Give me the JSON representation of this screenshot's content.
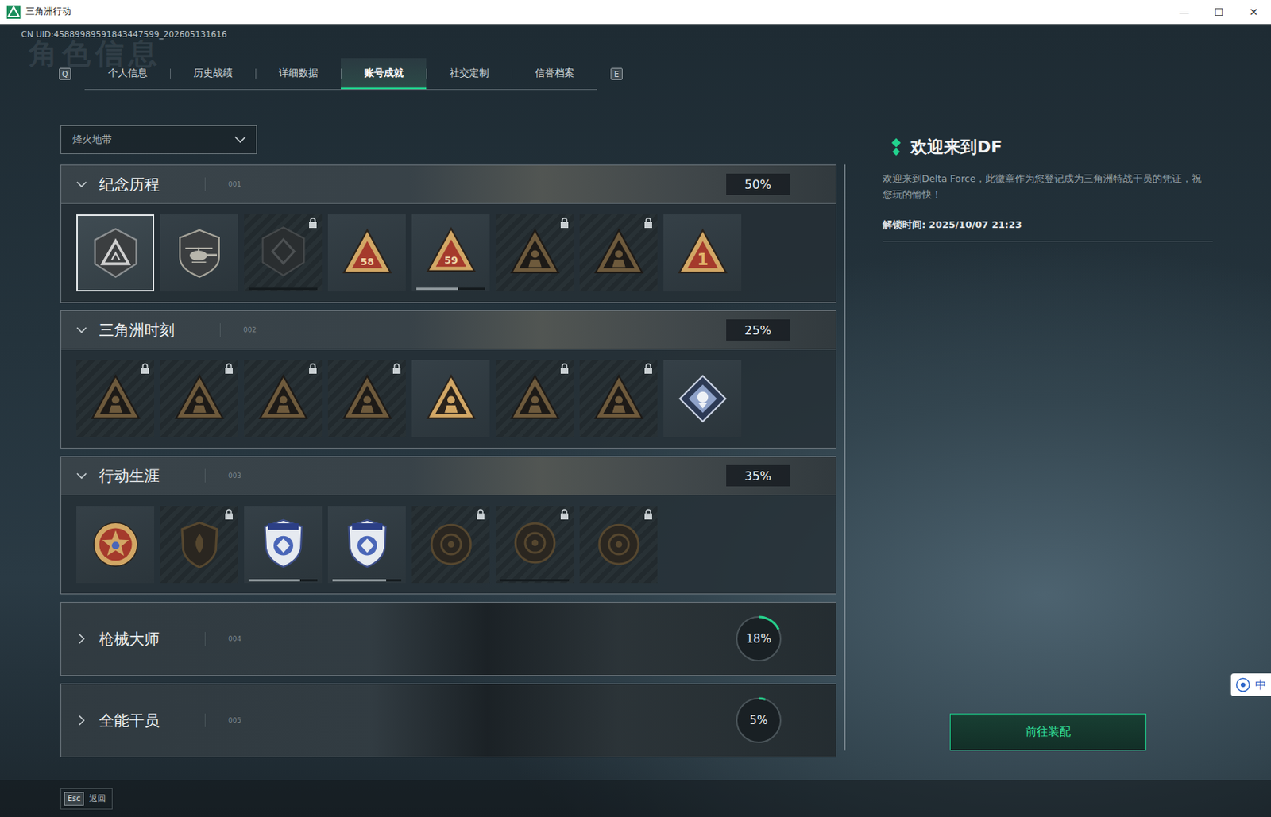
{
  "window": {
    "title": "三角洲行动",
    "controls": [
      "—",
      "☐",
      "✕"
    ]
  },
  "watermark": "角色信息",
  "uid": "CN UID:45889989591843447599_202605131616",
  "tabs": {
    "prev_key": "Q",
    "next_key": "E",
    "items": [
      {
        "label": "个人信息",
        "selected": false
      },
      {
        "label": "历史战绩",
        "selected": false
      },
      {
        "label": "详细数据",
        "selected": false
      },
      {
        "label": "账号成就",
        "selected": true
      },
      {
        "label": "社交定制",
        "selected": false
      },
      {
        "label": "信誉档案",
        "selected": false
      }
    ]
  },
  "mode_select": {
    "value": "烽火地带"
  },
  "sections": [
    {
      "title": "纪念历程",
      "number": "001",
      "percent": "50%",
      "expanded": true,
      "kind": "box",
      "badges": [
        {
          "locked": false,
          "selected": true
        },
        {
          "locked": false,
          "selected": false
        },
        {
          "locked": true,
          "selected": false,
          "progress": 0.0
        },
        {
          "locked": false,
          "selected": false,
          "mark": "58"
        },
        {
          "locked": false,
          "selected": false,
          "mark": "59",
          "progress": 0.6
        },
        {
          "locked": true,
          "selected": false
        },
        {
          "locked": true,
          "selected": false
        },
        {
          "locked": false,
          "selected": false,
          "mark": "1"
        }
      ]
    },
    {
      "title": "三角洲时刻",
      "number": "002",
      "percent": "25%",
      "expanded": true,
      "kind": "box",
      "badges": [
        {
          "locked": true,
          "selected": false
        },
        {
          "locked": true,
          "selected": false
        },
        {
          "locked": true,
          "selected": false
        },
        {
          "locked": true,
          "selected": false
        },
        {
          "locked": false,
          "selected": false
        },
        {
          "locked": true,
          "selected": false
        },
        {
          "locked": true,
          "selected": false
        },
        {
          "locked": false,
          "selected": false
        }
      ]
    },
    {
      "title": "行动生涯",
      "number": "003",
      "percent": "35%",
      "expanded": true,
      "kind": "box",
      "badges": [
        {
          "locked": false,
          "selected": false
        },
        {
          "locked": true,
          "selected": false
        },
        {
          "locked": false,
          "selected": false,
          "progress": 0.75
        },
        {
          "locked": false,
          "selected": false,
          "progress": 0.78
        },
        {
          "locked": true,
          "selected": false
        },
        {
          "locked": true,
          "selected": false,
          "progress": 0.0
        },
        {
          "locked": true,
          "selected": false
        }
      ]
    },
    {
      "title": "枪械大师",
      "number": "004",
      "percent": "18%",
      "expanded": false,
      "kind": "ring",
      "level": 0.18
    },
    {
      "title": "全能干员",
      "number": "005",
      "percent": "5%",
      "expanded": false,
      "kind": "ring",
      "level": 0.05
    }
  ],
  "detail": {
    "title": "欢迎来到DF",
    "description": "欢迎来到Delta Force，此徽章作为您登记成为三角洲特战干员的凭证，祝您玩的愉快！",
    "unlock_time": "解锁时间: 2025/10/07 21:23",
    "button": "前往装配"
  },
  "footer": {
    "key": "Esc",
    "label": "返回"
  },
  "ime": "中"
}
